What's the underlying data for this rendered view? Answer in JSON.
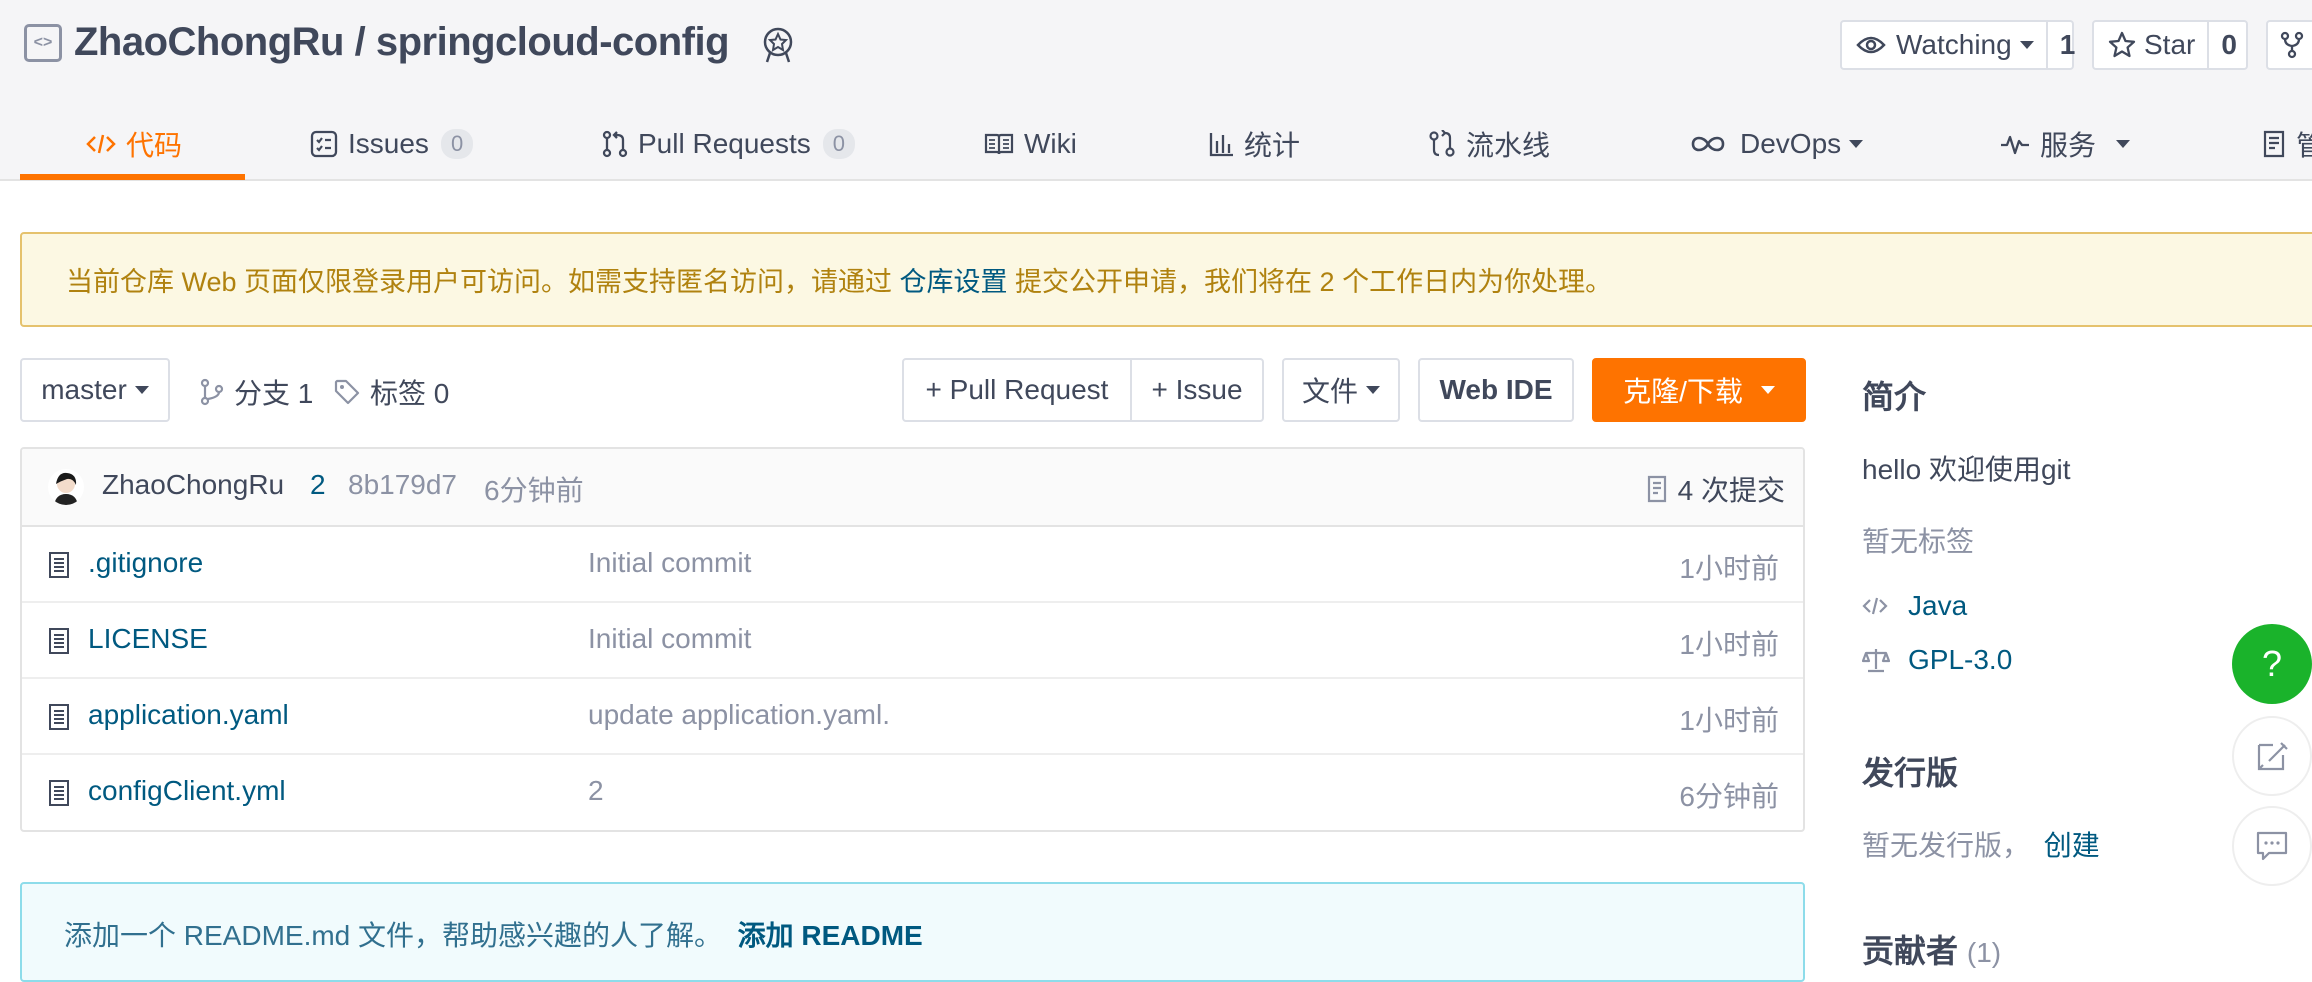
{
  "repo": {
    "title": "ZhaoChongRu / springcloud-config",
    "watch_label": "Watching",
    "watch_count": "1",
    "star_label": "Star",
    "star_count": "0"
  },
  "tabs": [
    {
      "label": "代码",
      "icon": "code-icon"
    },
    {
      "label": "Issues",
      "count": "0",
      "icon": "issues-icon"
    },
    {
      "label": "Pull Requests",
      "count": "0",
      "icon": "pull-request-icon"
    },
    {
      "label": "Wiki",
      "icon": "book-icon"
    },
    {
      "label": "统计",
      "icon": "bar-chart-icon"
    },
    {
      "label": "流水线",
      "icon": "pipeline-icon"
    },
    {
      "label": "DevOps",
      "icon": "infinity-icon"
    },
    {
      "label": "服务",
      "icon": "pulse-icon"
    },
    {
      "label": "管",
      "icon": "document-icon"
    }
  ],
  "notice": {
    "before": "当前仓库 Web 页面仅限登录用户可访问。如需支持匿名访问，请通过 ",
    "link": "仓库设置",
    "after": " 提交公开申请，我们将在 2 个工作日内为你处理。"
  },
  "toolbar": {
    "branch": "master",
    "branches": "分支 1",
    "tags": "标签 0",
    "pull_request": "+ Pull Request",
    "issue": "+ Issue",
    "files": "文件",
    "web_ide": "Web IDE",
    "clone": "克隆/下载"
  },
  "commit": {
    "author": "ZhaoChongRu",
    "message": "2",
    "hash": "8b179d7",
    "time": "6分钟前",
    "count": "4 次提交"
  },
  "files": [
    {
      "name": ".gitignore",
      "message": "Initial commit",
      "time": "1小时前"
    },
    {
      "name": "LICENSE",
      "message": "Initial commit",
      "time": "1小时前"
    },
    {
      "name": "application.yaml",
      "message": "update application.yaml.",
      "time": "1小时前"
    },
    {
      "name": "configClient.yml",
      "message": "2",
      "time": "6分钟前"
    }
  ],
  "readme_tip": {
    "text": "添加一个 README.md 文件，帮助感兴趣的人了解。 ",
    "link": "添加 README"
  },
  "sidebar": {
    "intro_title": "简介",
    "intro_text": "hello 欢迎使用git",
    "no_tags": "暂无标签",
    "language": "Java",
    "license": "GPL-3.0",
    "release_title": "发行版",
    "no_release": "暂无发行版，",
    "create": "创建",
    "contributors_title": "贡献者",
    "contributors_count": "(1)"
  },
  "floating": {
    "help": "?"
  },
  "colors": {
    "accent": "#fe7300",
    "link": "#005980",
    "help": "#1ab32b"
  }
}
